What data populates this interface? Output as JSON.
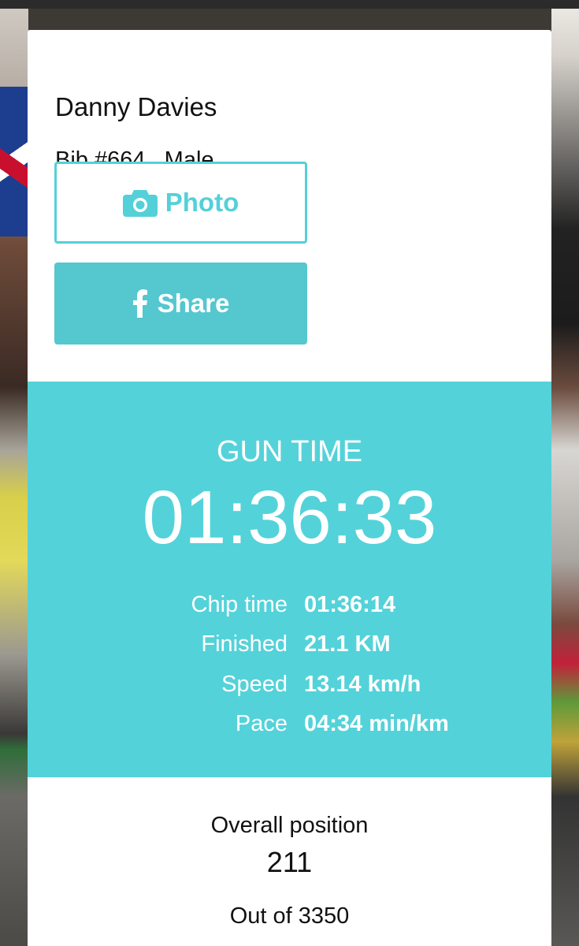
{
  "runner": {
    "name": "Danny Davies",
    "info": "Bib #664 , Male"
  },
  "buttons": {
    "photo_label": "Photo",
    "photo_icon": "camera-icon",
    "share_label": "Share",
    "share_icon": "facebook-icon"
  },
  "results": {
    "gun_time_label": "GUN TIME",
    "gun_time": "01:36:33",
    "stats": [
      {
        "label": "Chip time",
        "value": "01:36:14"
      },
      {
        "label": "Finished",
        "value": "21.1 KM"
      },
      {
        "label": "Speed",
        "value": "13.14 km/h"
      },
      {
        "label": "Pace",
        "value": "04:34 min/km"
      }
    ]
  },
  "position": {
    "label": "Overall position",
    "value": "211",
    "total": "Out of 3350"
  },
  "colors": {
    "accent": "#54d2d9",
    "share_bg": "#54c7cf",
    "photo_border": "#54d0d8"
  }
}
